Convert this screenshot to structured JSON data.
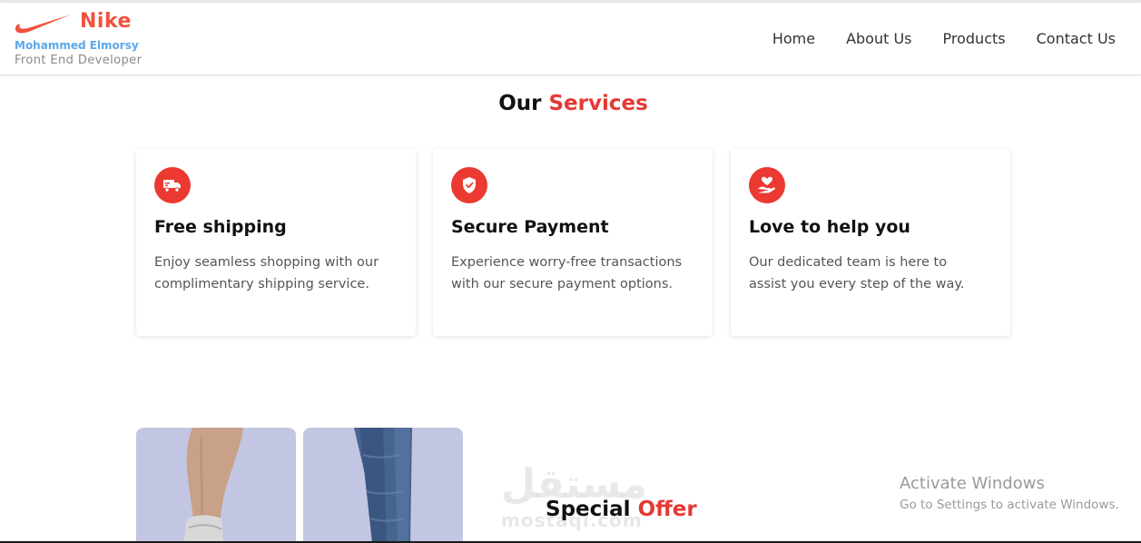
{
  "header": {
    "brand": "Nike",
    "author": "Mohammed Elmorsy",
    "role": "Front End Developer",
    "nav": [
      {
        "label": "Home"
      },
      {
        "label": "About Us"
      },
      {
        "label": "Products"
      },
      {
        "label": "Contact Us"
      }
    ]
  },
  "services": {
    "title_prefix": "Our",
    "title_accent": "Services",
    "cards": [
      {
        "icon": "truck-icon",
        "title": "Free shipping",
        "text": "Enjoy seamless shopping with our complimentary shipping service."
      },
      {
        "icon": "shield-check-icon",
        "title": "Secure Payment",
        "text": "Experience worry-free transactions with our secure payment options."
      },
      {
        "icon": "heart-hand-icon",
        "title": "Love to help you",
        "text": "Our dedicated team is here to assist you every step of the way."
      }
    ]
  },
  "offer": {
    "title_prefix": "Special",
    "title_accent": "Offer"
  },
  "watermark": {
    "arabic": "مستقل",
    "latin": "mostaql.com"
  },
  "system": {
    "activate_title": "Activate Windows",
    "activate_sub": "Go to Settings to activate Windows."
  },
  "colors": {
    "accent": "#e53935",
    "brand": "#f0523f",
    "author": "#5ba7e8",
    "product_bg": "#c3c6e2"
  }
}
